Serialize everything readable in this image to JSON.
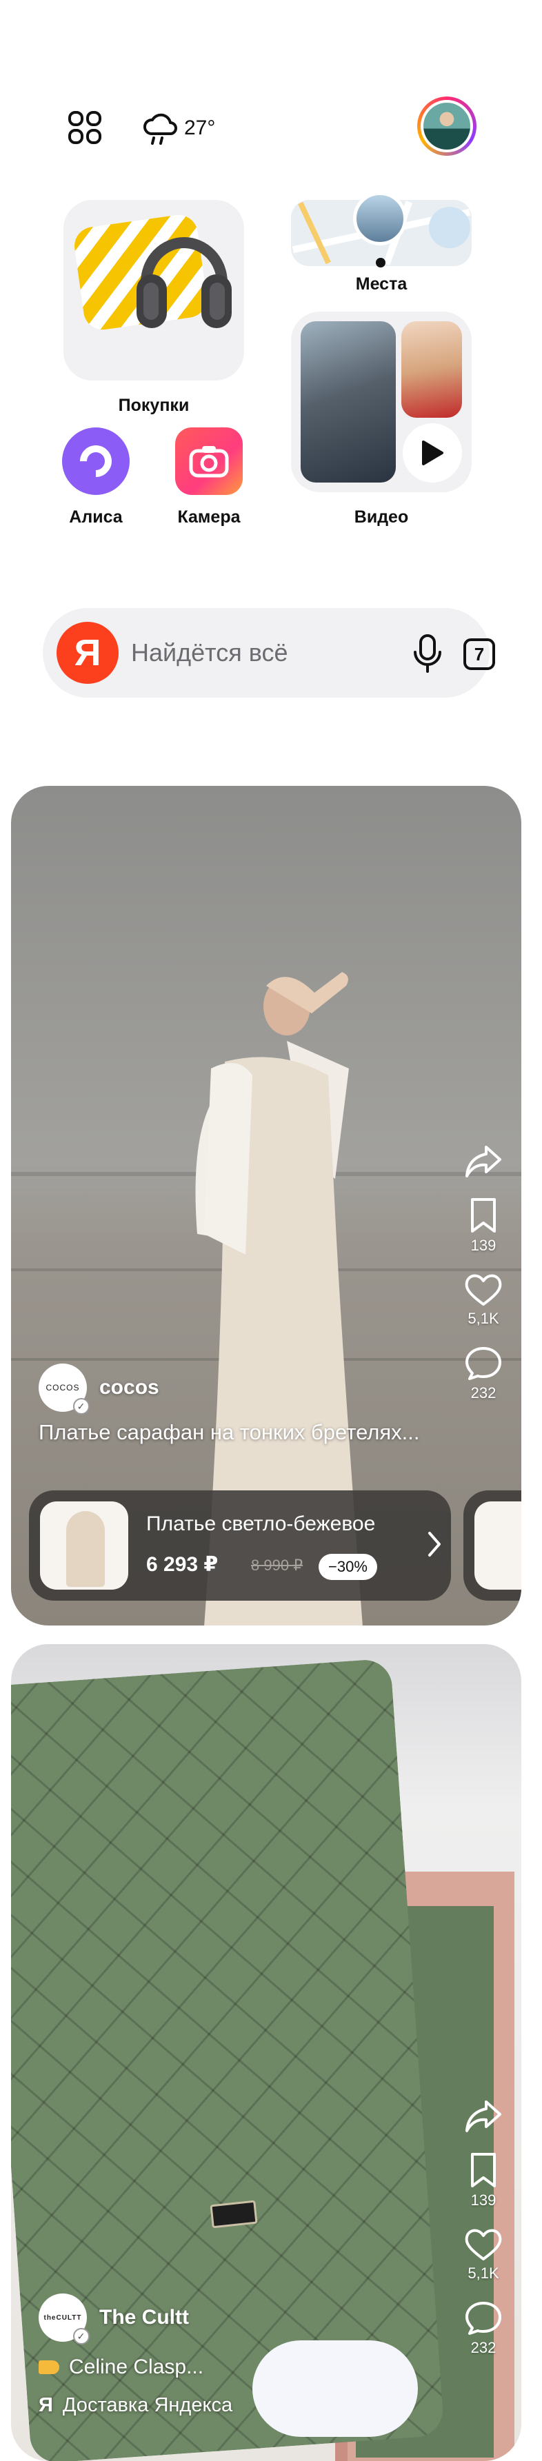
{
  "header": {
    "weather_temp": "27°",
    "weather_icon": "cloud-rain-icon",
    "menu_icon": "apps-grid-icon"
  },
  "widgets": {
    "shopping_label": "Покупки",
    "places_label": "Места",
    "video_label": "Видео",
    "alisa_label": "Алиса",
    "camera_label": "Камера"
  },
  "search": {
    "logo": "Я",
    "placeholder": "Найдётся всё",
    "tabs_count": "7"
  },
  "feed": [
    {
      "author": "cocos",
      "author_logo": "COCOS",
      "caption": "Платье сарафан на тонких бретелях...",
      "actions": {
        "bookmarks": "139",
        "likes": "5,1K",
        "comments": "232"
      },
      "product": {
        "name": "Платье светло-бежевое",
        "price": "6 293 ₽",
        "old_price": "8 990 ₽",
        "discount": "−30%"
      }
    },
    {
      "author": "The Cultt",
      "author_logo": "theCULTT",
      "chip": "Celine Clasp...",
      "source": "Доставка Яндекса",
      "source_logo": "Я",
      "actions": {
        "bookmarks": "139",
        "likes": "5,1K",
        "comments": "232"
      }
    }
  ],
  "colors": {
    "accent": "#fc3f1d",
    "alisa": "#8b5cf6",
    "surface": "#f1f1f4"
  }
}
